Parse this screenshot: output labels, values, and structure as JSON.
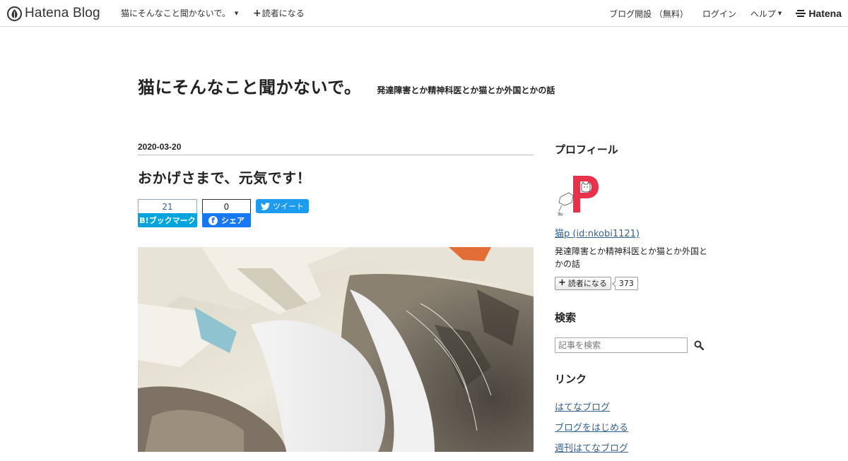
{
  "header": {
    "logo_text": "Hatena Blog",
    "blog_name": "猫にそんなこと聞かないで。",
    "subscribe_label": "読者になる",
    "open_blog_label": "ブログ開設 （無料）",
    "login_label": "ログイン",
    "help_label": "ヘルプ",
    "hatena_label": "Hatena"
  },
  "blog": {
    "title": "猫にそんなこと聞かないで。",
    "description": "発達障害とか精神科医とか猫とか外国とかの話"
  },
  "entry": {
    "date": "2020-03-20",
    "title": "おかげさまで、元気です！",
    "bookmark_count": "21",
    "bookmark_label": "ブックマーク",
    "bookmark_prefix": "B!",
    "share_count": "0",
    "share_label": "シェア",
    "tweet_label": "ツイート",
    "photo_alt": "cat-sleeping-photo"
  },
  "sidebar": {
    "profile_title": "プロフィール",
    "profile_name": "猫p (id:nkobi1121)",
    "profile_desc": "発達障害とか精神科医とか猫とか外国とかの話",
    "subscribe_label": "読者になる",
    "subscriber_count": "373",
    "search_title": "検索",
    "search_placeholder": "記事を検索",
    "links_title": "リンク",
    "links": [
      "はてなブログ",
      "ブログをはじめる",
      "週刊はてなブログ"
    ]
  },
  "colors": {
    "link": "#35618f",
    "bookmark_blue": "#00a4de",
    "facebook_blue": "#1877f2",
    "twitter_blue": "#1d9bf0",
    "profile_red": "#e8314b"
  },
  "icons": [
    "hatena-blog-logo-icon",
    "caret-down-icon",
    "plus-icon",
    "hatena-mark-icon",
    "twitter-bird-icon",
    "facebook-icon",
    "search-icon"
  ]
}
